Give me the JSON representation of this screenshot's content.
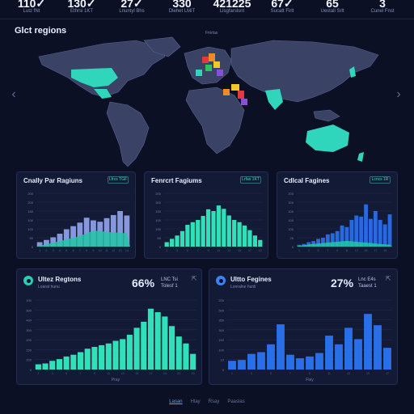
{
  "stats": [
    {
      "value": "110✓",
      "sub": "Lutz fNt"
    },
    {
      "value": "130✓",
      "sub": "Ethrsi 1KT"
    },
    {
      "value": "27✓",
      "sub": "Lnuntyl Bhs"
    },
    {
      "value": "330",
      "sub": "Dlehet LMiT"
    },
    {
      "value": "421225",
      "sub": "Llsgfarslsnt"
    },
    {
      "value": "67✓",
      "sub": "Sucatt Firlt"
    },
    {
      "value": "65",
      "sub": "Uestall Srlt"
    },
    {
      "value": "3",
      "sub": "Cunel Fnst"
    }
  ],
  "map": {
    "title": "Glct regions",
    "subtitle": "Fmrlas",
    "colors": {
      "land": "#3a4266",
      "border": "#5a6390",
      "teal": "#2fd6bb"
    }
  },
  "nav": {
    "left_icon": "chevron-left-icon",
    "right_icon": "chevron-right-icon",
    "left": "‹",
    "right": "›"
  },
  "panels": [
    {
      "title": "Cnally Par Ragiuns",
      "button": "Lfrcs TGF",
      "chart_data": {
        "type": "bar",
        "title": "Cnally Par Ragiuns",
        "y_ticks": [
          "200",
          "200",
          "160",
          "100",
          "100",
          "50",
          "0"
        ],
        "ylim": [
          0,
          240
        ],
        "values_back": [
          20,
          30,
          42,
          58,
          78,
          92,
          108,
          130,
          118,
          112,
          128,
          142,
          160,
          140
        ],
        "values_front": [
          5,
          10,
          18,
          25,
          32,
          40,
          48,
          60,
          72,
          70,
          66,
          64,
          62,
          60
        ],
        "colors": [
          "#8c9ee6",
          "#24c4a8"
        ]
      }
    },
    {
      "title": "Fenrcrt Fagiums",
      "button": "Lrfas 1KT",
      "chart_data": {
        "type": "bar",
        "title": "Fenrcrt Fagiums",
        "y_ticks": [
          "200",
          "300",
          "150",
          "100",
          "150",
          "50",
          "0"
        ],
        "ylim": [
          0,
          240
        ],
        "values": [
          20,
          35,
          50,
          70,
          98,
          110,
          120,
          138,
          168,
          160,
          185,
          170,
          140,
          120,
          110,
          95,
          74,
          50,
          30
        ],
        "colors": [
          "#2fe0b8"
        ]
      }
    },
    {
      "title": "Cdlcal Fagines",
      "button": "Lcncs 1R",
      "chart_data": {
        "type": "bar",
        "title": "Cdlcal Fagines",
        "y_ticks": [
          "200",
          "300",
          "100",
          "100",
          "100",
          "25",
          "0"
        ],
        "ylim": [
          0,
          240
        ],
        "values_back": [
          8,
          12,
          20,
          25,
          35,
          40,
          55,
          60,
          70,
          95,
          88,
          120,
          140,
          135,
          190,
          125,
          160,
          120,
          100,
          145
        ],
        "values_front": [
          4,
          6,
          10,
          12,
          14,
          16,
          18,
          20,
          22,
          24,
          26,
          24,
          22,
          20,
          18,
          16,
          14,
          12,
          10,
          9
        ],
        "colors": [
          "#2a6ee8",
          "#22c7a9"
        ]
      }
    }
  ],
  "bottom_panels": [
    {
      "title": "Ultez Regtons",
      "sub": "Loarat hunu",
      "pct": "66%",
      "meta1": "LNC Tsi",
      "meta2": "Tolesf 1",
      "icon_color": "#27cdb7",
      "chart_data": {
        "type": "bar",
        "title": "Ultez Regtons",
        "y_ticks": [
          "100",
          "500",
          "400",
          "300",
          "200",
          "150",
          "200",
          "0"
        ],
        "ylim": [
          0,
          160
        ],
        "x_label": "Pray",
        "values": [
          12,
          14,
          20,
          24,
          30,
          34,
          40,
          48,
          52,
          56,
          60,
          66,
          70,
          80,
          96,
          110,
          140,
          132,
          122,
          100,
          76,
          60,
          36
        ],
        "colors": [
          "#2fe0b8"
        ]
      }
    },
    {
      "title": "Ultto Fegines",
      "sub": "Lonralne hunli",
      "pct": "27%",
      "meta1": "Lnc E4s",
      "meta2": "Taaest 1",
      "icon_color": "#3b82f6",
      "chart_data": {
        "type": "bar",
        "title": "Ultto Fegines",
        "y_ticks": [
          "200",
          "500",
          "350",
          "300",
          "150",
          "100",
          "10",
          "0"
        ],
        "ylim": [
          0,
          160
        ],
        "x_label": "Fiay",
        "values": [
          20,
          22,
          36,
          40,
          58,
          104,
          34,
          26,
          30,
          38,
          78,
          58,
          96,
          70,
          128,
          102,
          50
        ],
        "colors": [
          "#2a6ee8"
        ]
      }
    }
  ],
  "footer": {
    "links": [
      "Lasan",
      "Hlay",
      "Rsay",
      "Paaslas"
    ]
  }
}
